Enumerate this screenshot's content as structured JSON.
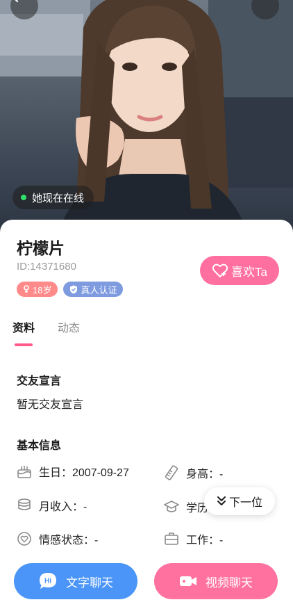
{
  "hero": {
    "online_status": "她现在在线",
    "back_icon": "chevron-left-icon",
    "more_icon": "more-dots-icon"
  },
  "profile": {
    "name": "柠檬片",
    "id_text": "ID:14371680",
    "age_tag": "18岁",
    "verify_tag": "真人认证",
    "like_label": "喜欢Ta"
  },
  "tabs": [
    {
      "label": "资料",
      "active": true
    },
    {
      "label": "动态",
      "active": false
    }
  ],
  "declaration": {
    "title": "交友宣言",
    "text": "暂无交友宣言"
  },
  "basic_info": {
    "title": "基本信息",
    "items": [
      {
        "label": "生日：2007-09-27",
        "icon": "cake-icon"
      },
      {
        "label": "身高：-",
        "icon": "ruler-icon"
      },
      {
        "label": "月收入：-",
        "icon": "coins-icon"
      },
      {
        "label": "学历",
        "icon": "graduation-cap-icon"
      },
      {
        "label": "情感状态：-",
        "icon": "heart-status-icon"
      },
      {
        "label": "工作：-",
        "icon": "briefcase-icon"
      }
    ]
  },
  "next_button": "下一位",
  "actions": {
    "text_chat": "文字聊天",
    "video_chat": "视频聊天",
    "chat_badge": "Hi"
  },
  "colors": {
    "accent_pink": "#ff6fa0",
    "accent_blue": "#4a95f7",
    "online_green": "#2fe36a"
  }
}
